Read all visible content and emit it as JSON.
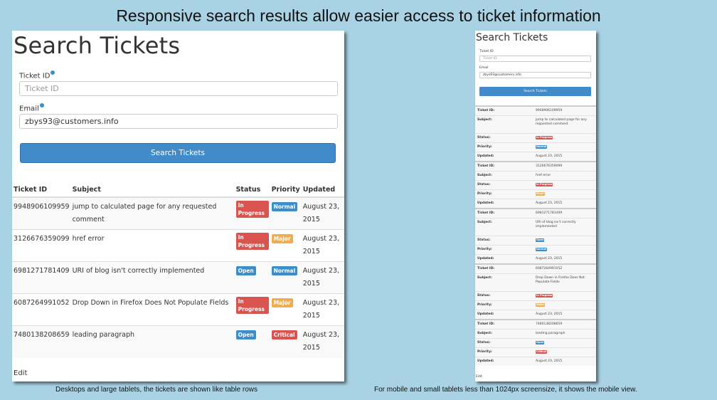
{
  "headline": "Responsive search results allow easier access to ticket information",
  "search": {
    "title": "Search Tickets",
    "ticket_id_label": "Ticket ID",
    "ticket_id_placeholder": "Ticket ID",
    "email_label": "Email",
    "email_value": "zbys93@customers.info",
    "button_label": "Search Tickets"
  },
  "table": {
    "headers": [
      "Ticket ID",
      "Subject",
      "Status",
      "Priority",
      "Updated"
    ],
    "rows": [
      {
        "id": "9948906109959",
        "subject": "jump to calculated page for any requested comment",
        "status": "In Progress",
        "priority": "Normal",
        "updated": "August 23, 2015"
      },
      {
        "id": "3126676359099",
        "subject": "href error",
        "status": "In Progress",
        "priority": "Major",
        "updated": "August 23, 2015"
      },
      {
        "id": "6981271781409",
        "subject": "URI of blog isn't correctly implemented",
        "status": "Open",
        "priority": "Normal",
        "updated": "August 23, 2015"
      },
      {
        "id": "6087264991052",
        "subject": "Drop Down in Firefox Does Not Populate Fields",
        "status": "In Progress",
        "priority": "Major",
        "updated": "August 23, 2015"
      },
      {
        "id": "7480138208659",
        "subject": "leading paragraph",
        "status": "Open",
        "priority": "Critical",
        "updated": "August 23, 2015"
      }
    ]
  },
  "mobile_labels": {
    "ticket_id": "Ticket ID:",
    "subject": "Subject:",
    "status": "Status:",
    "priority": "Priority:",
    "updated": "Updated:"
  },
  "edit_label": "Edit",
  "captions": {
    "desktop": "Desktops and large tablets, the tickets are shown like table rows",
    "mobile": "For mobile and small tablets less than 1024px screensize, it shows the mobile view."
  },
  "colors": {
    "background": "#a9d3e4",
    "primary": "#428bca",
    "danger": "#d9534f",
    "warning": "#f0ad4e",
    "info": "#3a8ec9"
  }
}
